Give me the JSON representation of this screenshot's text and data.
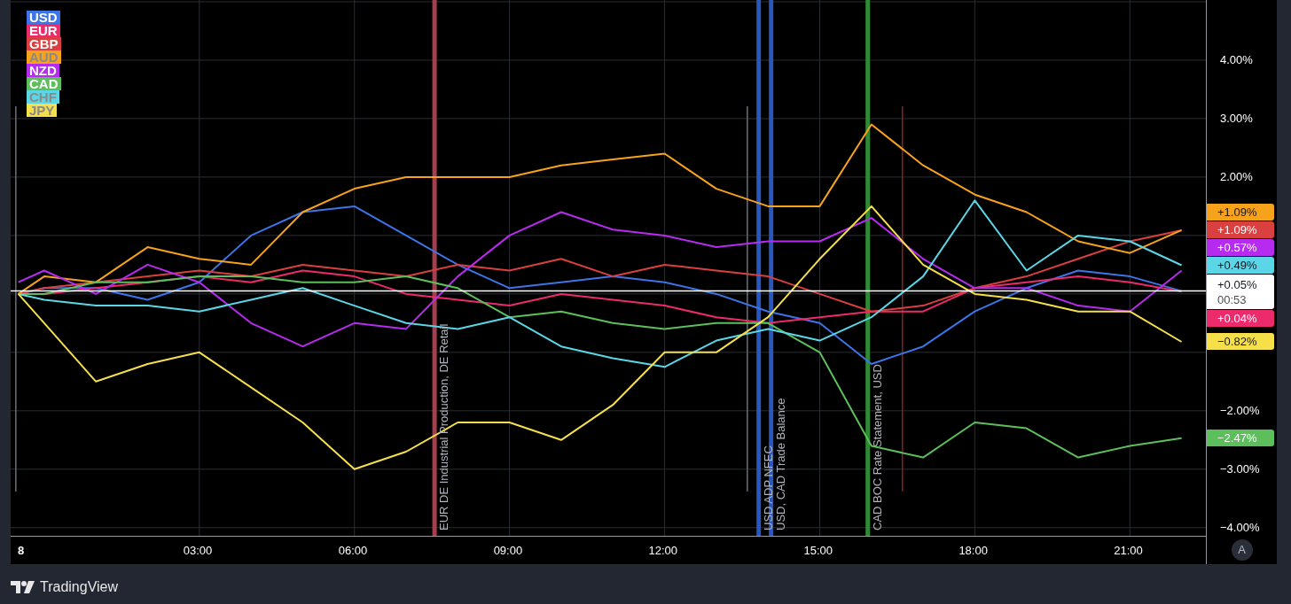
{
  "chart": {
    "chart_data": {
      "type": "line",
      "x": [
        -0.5,
        0,
        1,
        2,
        3,
        4,
        5,
        6,
        7,
        8,
        9,
        10,
        11,
        12,
        13,
        14,
        15,
        16,
        17,
        18,
        19,
        20,
        21,
        22
      ],
      "xlim": [
        -0.65,
        22.47
      ],
      "ylim": [
        -4.14,
        5.03
      ],
      "xticks": [
        {
          "value": 3,
          "label": "03:00"
        },
        {
          "value": 6,
          "label": "06:00"
        },
        {
          "value": 9,
          "label": "09:00"
        },
        {
          "value": 12,
          "label": "12:00"
        },
        {
          "value": 15,
          "label": "15:00"
        },
        {
          "value": 18,
          "label": "18:00"
        },
        {
          "value": 21,
          "label": "21:00"
        }
      ],
      "yticks": [
        {
          "value": 4,
          "label": "4.00%"
        },
        {
          "value": 3,
          "label": "3.00%"
        },
        {
          "value": 2,
          "label": "2.00%"
        },
        {
          "value": -2,
          "label": "−2.00%"
        },
        {
          "value": -3,
          "label": "−3.00%"
        },
        {
          "value": -4,
          "label": "−4.00%"
        }
      ],
      "series": [
        {
          "name": "USD",
          "color": "#3d74e8",
          "values": [
            0,
            0.1,
            0.1,
            -0.1,
            0.2,
            1.0,
            1.4,
            1.5,
            1.0,
            0.5,
            0.1,
            0.2,
            0.3,
            0.2,
            0.0,
            -0.3,
            -0.5,
            -1.2,
            -0.9,
            -0.3,
            0.1,
            0.4,
            0.3,
            0.05
          ]
        },
        {
          "name": "EUR",
          "color": "#ec2a6c",
          "values": [
            0,
            0.0,
            0.1,
            0.2,
            0.3,
            0.2,
            0.4,
            0.3,
            0.0,
            -0.1,
            -0.2,
            0.0,
            -0.1,
            -0.2,
            -0.4,
            -0.5,
            -0.4,
            -0.3,
            -0.3,
            0.1,
            0.2,
            0.3,
            0.2,
            0.04
          ]
        },
        {
          "name": "GBP",
          "color": "#d9403f",
          "values": [
            0,
            0.1,
            0.2,
            0.3,
            0.4,
            0.3,
            0.5,
            0.4,
            0.3,
            0.5,
            0.4,
            0.6,
            0.3,
            0.5,
            0.4,
            0.3,
            0.0,
            -0.3,
            -0.2,
            0.1,
            0.3,
            0.6,
            0.9,
            1.09
          ]
        },
        {
          "name": "AUD",
          "color": "#f7a21b",
          "values": [
            0,
            0.3,
            0.2,
            0.8,
            0.6,
            0.5,
            1.4,
            1.8,
            2.0,
            2.0,
            2.0,
            2.2,
            2.3,
            2.4,
            1.8,
            1.5,
            1.5,
            2.9,
            2.2,
            1.7,
            1.4,
            0.9,
            0.7,
            1.09
          ]
        },
        {
          "name": "NZD",
          "color": "#b72bf0",
          "values": [
            0.2,
            0.4,
            0.0,
            0.5,
            0.2,
            -0.5,
            -0.9,
            -0.5,
            -0.6,
            0.3,
            1.0,
            1.4,
            1.1,
            1.0,
            0.8,
            0.9,
            0.9,
            1.3,
            0.6,
            0.1,
            0.1,
            -0.2,
            -0.3,
            0.4
          ]
        },
        {
          "name": "CAD",
          "color": "#5cbf5c",
          "values": [
            0,
            0.0,
            0.2,
            0.2,
            0.3,
            0.3,
            0.2,
            0.2,
            0.3,
            0.1,
            -0.4,
            -0.3,
            -0.5,
            -0.6,
            -0.5,
            -0.5,
            -1.0,
            -2.6,
            -2.8,
            -2.2,
            -2.3,
            -2.8,
            -2.6,
            -2.47
          ]
        },
        {
          "name": "CHF",
          "color": "#5ad6e6",
          "values": [
            0,
            -0.1,
            -0.2,
            -0.2,
            -0.3,
            -0.1,
            0.1,
            -0.2,
            -0.5,
            -0.6,
            -0.4,
            -0.9,
            -1.1,
            -1.25,
            -0.8,
            -0.6,
            -0.8,
            -0.4,
            0.3,
            1.6,
            0.4,
            1.0,
            0.9,
            0.49
          ]
        },
        {
          "name": "JPY",
          "color": "#f5e04a",
          "values": [
            0,
            -0.5,
            -1.5,
            -1.2,
            -1.0,
            -1.6,
            -2.2,
            -3.0,
            -2.7,
            -2.2,
            -2.2,
            -2.5,
            -1.9,
            -1.0,
            -1.0,
            -0.4,
            0.6,
            1.5,
            0.5,
            0.0,
            -0.1,
            -0.3,
            -0.3,
            -0.82
          ]
        }
      ],
      "grid": true,
      "ref_lines": [
        {
          "axis": "x",
          "value": -0.55,
          "color": "#6b6f78"
        },
        {
          "axis": "x",
          "value": 7.55,
          "color": "#a3404f",
          "label": "EUR DE Industrial Production, DE Retail"
        },
        {
          "axis": "x",
          "value": 13.6,
          "color": "#6b6f78"
        },
        {
          "axis": "x",
          "value": 13.82,
          "color": "#2a56c0",
          "label": "USD ADP NFEC"
        },
        {
          "axis": "x",
          "value": 14.06,
          "color": "#2a56c0",
          "label": "USD, CAD Trade Balance"
        },
        {
          "axis": "x",
          "value": 15.93,
          "color": "#2f8a35",
          "label": "CAD BOC Rate Statement, USD"
        },
        {
          "axis": "x",
          "value": 16.6,
          "color": "#8a1f1f"
        },
        {
          "axis": "y",
          "value": 0.05,
          "color": "#ffffff"
        }
      ]
    },
    "date_label": "8",
    "price_labels": [
      {
        "text": "+1.09%",
        "color": "#f7a21b"
      },
      {
        "text": "+1.09%",
        "color": "#d9403f"
      },
      {
        "text": "+0.57%",
        "color": "#b72bf0"
      },
      {
        "text": "+0.49%",
        "color": "#5ad6e6"
      },
      {
        "kind": "current",
        "text": "+0.05%",
        "time": "00:53",
        "color": "#ffffff"
      },
      {
        "text": "+0.04%",
        "color": "#ec2a6c"
      },
      {
        "text": "−0.82%",
        "color": "#f5e04a"
      },
      {
        "text": "−2.47%",
        "color": "#5cbf5c"
      }
    ],
    "scale_button": "A"
  },
  "footer": {
    "brand": "TradingView"
  }
}
